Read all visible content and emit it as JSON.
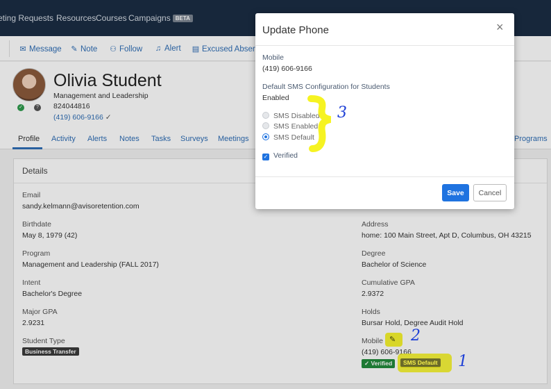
{
  "topnav": {
    "items": [
      "eting Requests",
      "Resources",
      "Courses",
      "Campaigns"
    ],
    "beta_badge": "BETA"
  },
  "actions": {
    "items": [
      {
        "label": "Message",
        "icon": "envelope-icon"
      },
      {
        "label": "Note",
        "icon": "note-icon"
      },
      {
        "label": "Follow",
        "icon": "add-user-icon"
      },
      {
        "label": "Alert",
        "icon": "bell-icon"
      },
      {
        "label": "Excused Absence",
        "icon": "document-icon"
      }
    ]
  },
  "student": {
    "name": "Olivia Student",
    "program": "Management and Leadership",
    "id": "824044816",
    "phone": "(419) 606-9166",
    "phone_check": "✓"
  },
  "tabs": [
    "Profile",
    "Activity",
    "Alerts",
    "Notes",
    "Tasks",
    "Surveys",
    "Meetings",
    "Programs"
  ],
  "details": {
    "title": "Details",
    "left": [
      {
        "label": "Email",
        "value": "sandy.kelmann@avisoretention.com"
      },
      {
        "label": "Birthdate",
        "value": "May 8, 1979 (42)"
      },
      {
        "label": "Program",
        "value": "Management and Leadership (FALL 2017)"
      },
      {
        "label": "Intent",
        "value": "Bachelor's Degree"
      },
      {
        "label": "Major GPA",
        "value": "2.9231"
      },
      {
        "label": "Student Type",
        "badge": "Business Transfer"
      }
    ],
    "right": [
      {
        "label": "Address",
        "value": "home: 100 Main Street, Apt D, Columbus, OH 43215"
      },
      {
        "label": "Degree",
        "value": "Bachelor of Science"
      },
      {
        "label": "Cumulative GPA",
        "value": "2.9372"
      },
      {
        "label": "Holds",
        "value": "Bursar Hold, Degree Audit Hold"
      }
    ],
    "mobile": {
      "label": "Mobile",
      "value": "(419) 606-9166",
      "verified_badge": "✓ Verified",
      "sms_badge": "SMS Default"
    }
  },
  "modal": {
    "title": "Update Phone",
    "close": "×",
    "mobile_label": "Mobile",
    "mobile_value": "(419) 606-9166",
    "sms_config_label": "Default SMS Configuration for Students",
    "sms_config_value": "Enabled",
    "options": [
      "SMS Disabled",
      "SMS Enabled",
      "SMS Default"
    ],
    "selected_option": "SMS Default",
    "verified_label": "Verified",
    "verified_checked": true,
    "save_label": "Save",
    "cancel_label": "Cancel"
  },
  "annotations": {
    "numbers": [
      "1",
      "2",
      "3"
    ],
    "highlight_color": "#f5f20a",
    "pen_color": "#1d3fd6"
  }
}
